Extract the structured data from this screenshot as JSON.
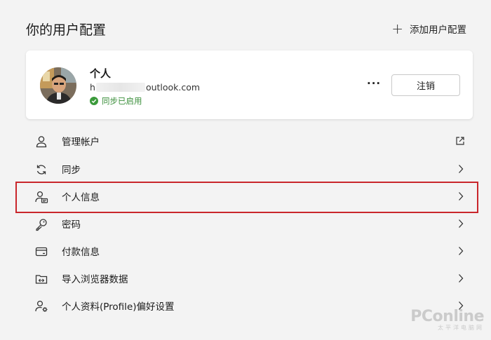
{
  "page": {
    "title": "你的用户配置",
    "add_profile_label": "添加用户配置"
  },
  "profile": {
    "name": "个人",
    "email_prefix": "h",
    "email_suffix": "outlook.com",
    "sync_status": "同步已启用",
    "more_label": "···",
    "signout_label": "注销"
  },
  "menu": {
    "items": [
      {
        "label": "管理帐户",
        "icon": "user-icon",
        "action_icon": "external-link-icon"
      },
      {
        "label": "同步",
        "icon": "sync-icon",
        "action_icon": "chevron-right-icon"
      },
      {
        "label": "个人信息",
        "icon": "personal-info-icon",
        "action_icon": "chevron-right-icon"
      },
      {
        "label": "密码",
        "icon": "key-icon",
        "action_icon": "chevron-right-icon"
      },
      {
        "label": "付款信息",
        "icon": "credit-card-icon",
        "action_icon": "chevron-right-icon"
      },
      {
        "label": "导入浏览器数据",
        "icon": "import-folder-icon",
        "action_icon": "chevron-right-icon"
      },
      {
        "label": "个人资料(Profile)偏好设置",
        "icon": "user-settings-icon",
        "action_icon": "chevron-right-icon"
      }
    ]
  },
  "watermark": {
    "main": "PConline",
    "sub": "太平洋电脑网"
  },
  "colors": {
    "background": "#f3f3f3",
    "card": "#ffffff",
    "sync_green": "#3b8f3b",
    "highlight_red": "#c9262b"
  }
}
